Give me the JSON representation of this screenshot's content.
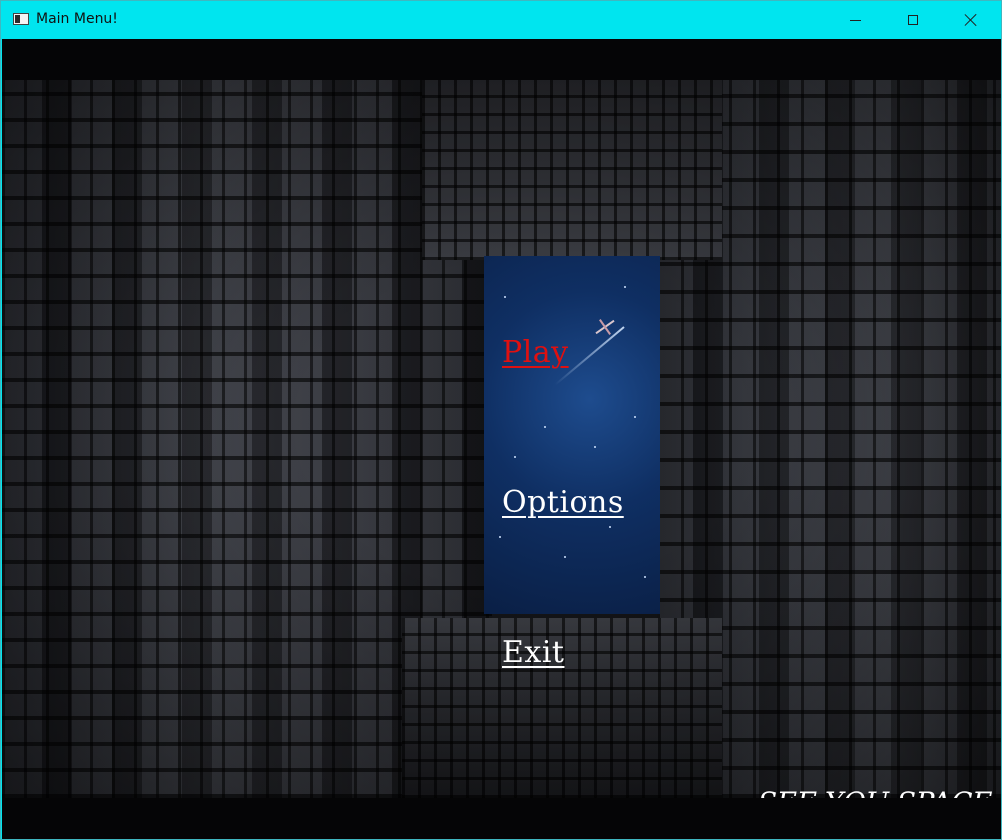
{
  "window": {
    "title": "Main Menu!",
    "icons": {
      "app": "app-window-icon",
      "minimize": "minimize-icon",
      "maximize": "maximize-icon",
      "close": "close-icon"
    },
    "titlebar_color": "#00e5ef"
  },
  "menu": {
    "play_label": "Play",
    "options_label": "Options",
    "exit_label": "Exit",
    "active_color": "#e01010",
    "default_color": "#ffffff"
  },
  "tagline": "SEE YOU SPACE"
}
